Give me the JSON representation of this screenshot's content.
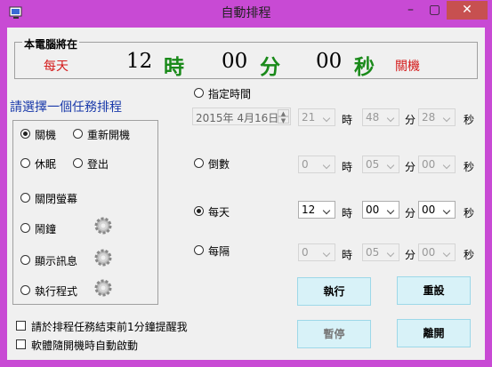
{
  "window": {
    "title": "自動排程"
  },
  "titlebar": {
    "minimize": "–",
    "maximize": "▢",
    "close": "✕"
  },
  "status": {
    "legend": "本電腦將在",
    "mode": "每天",
    "hour": "12",
    "hour_unit": "時",
    "minute": "00",
    "minute_unit": "分",
    "second": "00",
    "second_unit": "秒",
    "action": "關機"
  },
  "tasks": {
    "heading": "請選擇一個任務排程",
    "shutdown": "關機",
    "restart": "重新開機",
    "sleep": "休眠",
    "logout": "登出",
    "screen_off": "關閉螢幕",
    "alarm": "鬧鐘",
    "message": "顯示訊息",
    "run_program": "執行程式"
  },
  "schedule": {
    "specific": {
      "label": "指定時間",
      "date": "2015年  4月16日",
      "hour": "21",
      "minute": "48",
      "second": "28"
    },
    "countdown": {
      "label": "倒數",
      "hour": "0",
      "minute": "05",
      "second": "00"
    },
    "daily": {
      "label": "每天",
      "hour": "12",
      "minute": "00",
      "second": "00"
    },
    "every": {
      "label": "每隔",
      "hour": "0",
      "minute": "05",
      "second": "00"
    },
    "unit_hour": "時",
    "unit_minute": "分",
    "unit_second": "秒"
  },
  "options": {
    "remind": "請於排程任務結束前1分鐘提醒我",
    "autostart": "軟體隨開機時自動啟動"
  },
  "buttons": {
    "run": "執行",
    "reset": "重設",
    "pause": "暫停",
    "exit": "離開"
  },
  "colors": {
    "titlebar": "#c84ad4",
    "close": "#c75050",
    "accent_red": "#d41a1a",
    "accent_green": "#1a8a1a",
    "heading_blue": "#1a3aaa",
    "button_bg": "#d8f2f8"
  }
}
